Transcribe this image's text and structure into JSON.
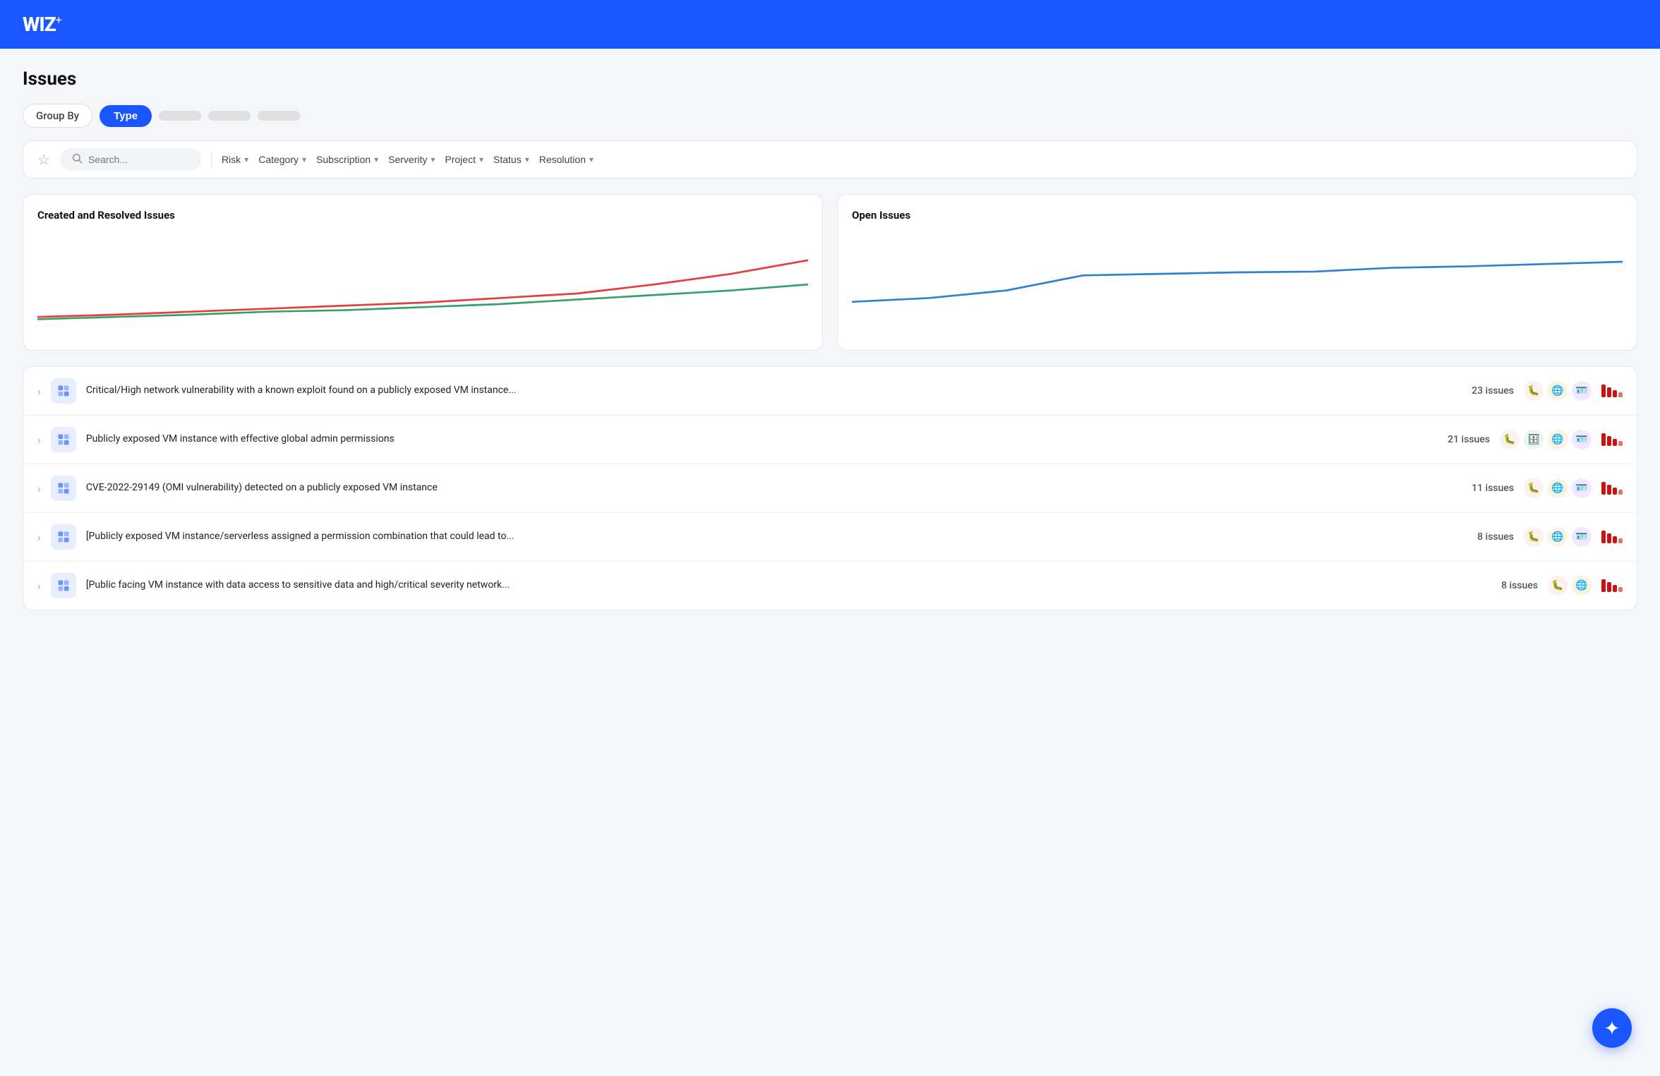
{
  "header": {
    "logo": "WIZ",
    "logo_sup": "+"
  },
  "page": {
    "title": "Issues"
  },
  "group_by": {
    "label": "Group By",
    "buttons": [
      {
        "id": "type",
        "label": "Type",
        "active": true
      },
      {
        "id": "b2",
        "label": "",
        "active": false
      },
      {
        "id": "b3",
        "label": "",
        "active": false
      },
      {
        "id": "b4",
        "label": "",
        "active": false
      }
    ]
  },
  "filters": {
    "search_placeholder": "Search...",
    "items": [
      {
        "id": "risk",
        "label": "Risk"
      },
      {
        "id": "category",
        "label": "Category"
      },
      {
        "id": "subscription",
        "label": "Subscription"
      },
      {
        "id": "severity",
        "label": "Serverity"
      },
      {
        "id": "project",
        "label": "Project"
      },
      {
        "id": "status",
        "label": "Status"
      },
      {
        "id": "resolution",
        "label": "Resolution"
      }
    ]
  },
  "charts": {
    "left": {
      "title": "Created and Resolved Issues"
    },
    "right": {
      "title": "Open Issues"
    }
  },
  "issues": [
    {
      "id": 1,
      "text": "Critical/High network vulnerability with a known exploit found on a publicly exposed VM instance...",
      "count": "23 issues",
      "tags": [
        "bug-red",
        "globe-orange",
        "card-purple"
      ],
      "bars": [
        4,
        4,
        4,
        3
      ]
    },
    {
      "id": 2,
      "text": "Publicly exposed VM instance with effective global admin permissions",
      "count": "21 issues",
      "tags": [
        "bug-red",
        "db-green",
        "globe-orange",
        "card-purple"
      ],
      "bars": [
        4,
        4,
        4,
        3
      ]
    },
    {
      "id": 3,
      "text": "CVE-2022-29149 (OMI vulnerability) detected on a publicly exposed VM instance",
      "count": "11 issues",
      "tags": [
        "bug-red",
        "globe-orange",
        "card-purple"
      ],
      "bars": [
        4,
        4,
        4,
        3
      ]
    },
    {
      "id": 4,
      "text": "[Publicly exposed VM instance/serverless assigned a permission combination that could lead to...",
      "count": "8 issues",
      "tags": [
        "bug-red",
        "globe-orange",
        "card-purple"
      ],
      "bars": [
        4,
        4,
        4,
        3
      ]
    },
    {
      "id": 5,
      "text": "[Public facing VM instance with data access to sensitive data and high/critical severity network...",
      "count": "8 issues",
      "tags": [
        "bug-red",
        "globe-orange"
      ],
      "bars": [
        4,
        4,
        4,
        3
      ]
    }
  ]
}
